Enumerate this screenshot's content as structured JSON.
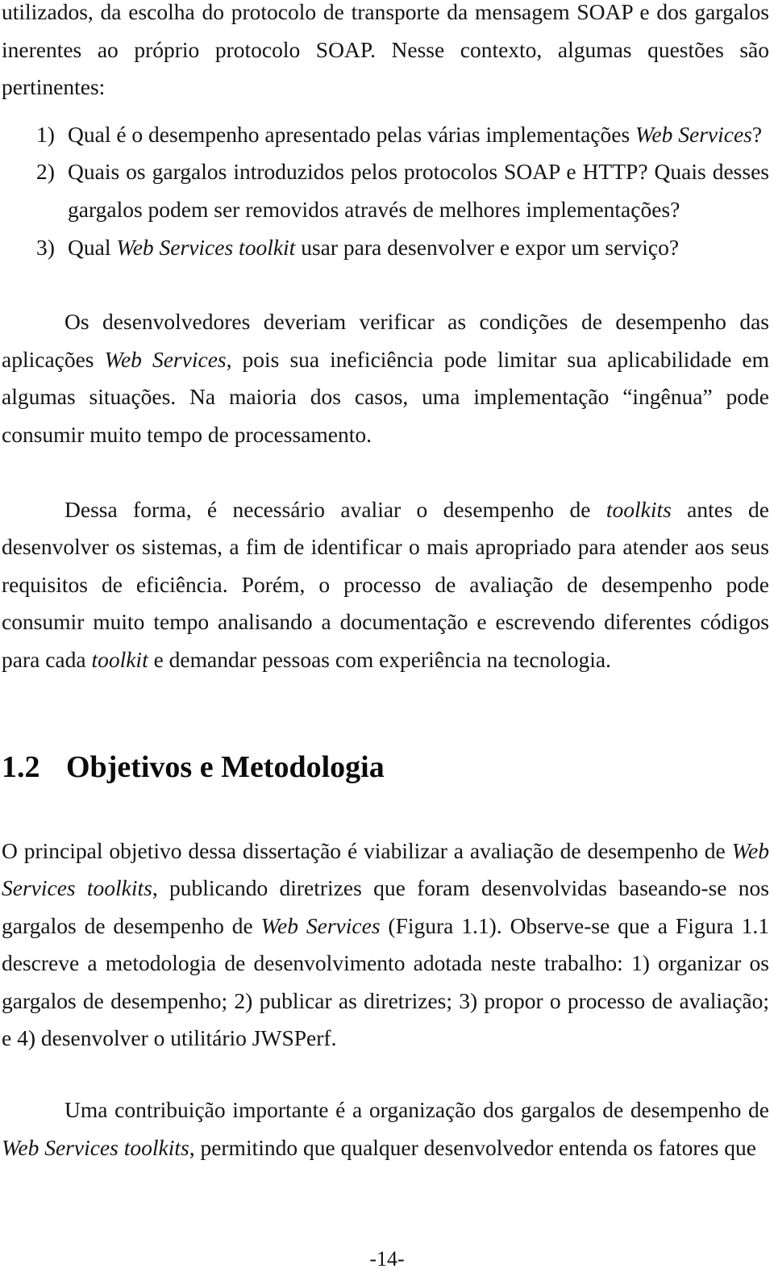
{
  "document": {
    "language": "pt-BR",
    "page_number_label": "-14-",
    "background_color": "#ffffff",
    "text_color": "#141414"
  },
  "body": {
    "paragraph_continuation": {
      "segments": [
        {
          "text": "utilizados, da escolha do protocolo de transporte da mensagem SOAP e dos gargalos inerentes ao próprio protocolo SOAP. Nesse contexto, algumas questões são pertinentes:",
          "style": "normal"
        }
      ]
    },
    "question_list": {
      "items": [
        {
          "marker": "1)",
          "segments": [
            {
              "text": "Qual é o desempenho apresentado pelas várias implementações ",
              "style": "normal"
            },
            {
              "text": "Web Services",
              "style": "italic"
            },
            {
              "text": "?",
              "style": "normal"
            }
          ]
        },
        {
          "marker": "2)",
          "segments": [
            {
              "text": "Quais os gargalos introduzidos pelos protocolos SOAP e HTTP? Quais desses gargalos podem ser removidos através de melhores implementações?",
              "style": "normal"
            }
          ]
        },
        {
          "marker": "3)",
          "segments": [
            {
              "text": "Qual ",
              "style": "normal"
            },
            {
              "text": "Web Services toolkit",
              "style": "italic"
            },
            {
              "text": " usar para desenvolver e expor um serviço?",
              "style": "normal"
            }
          ]
        }
      ]
    },
    "paragraph_developers": {
      "segments": [
        {
          "text": "Os desenvolvedores deveriam verificar as condições de desempenho das aplicações ",
          "style": "normal"
        },
        {
          "text": "Web Services",
          "style": "italic"
        },
        {
          "text": ", pois sua ineficiência pode limitar sua aplicabilidade em algumas situações. Na maioria dos casos, uma implementação “ingênua” pode consumir muito tempo de processamento.",
          "style": "normal"
        }
      ]
    },
    "paragraph_evaluation": {
      "segments": [
        {
          "text": "Dessa forma, é necessário avaliar o desempenho de ",
          "style": "normal"
        },
        {
          "text": "toolkits",
          "style": "italic"
        },
        {
          "text": " antes de desenvolver os sistemas, a fim de identificar o mais apropriado para atender aos seus requisitos de eficiência. Porém, o processo de avaliação de desempenho pode consumir muito tempo analisando a documentação e escrevendo diferentes códigos para cada ",
          "style": "normal"
        },
        {
          "text": "toolkit",
          "style": "italic"
        },
        {
          "text": " e demandar pessoas com experiência na tecnologia.",
          "style": "normal"
        }
      ]
    },
    "section_heading": {
      "number": "1.2",
      "title": "Objetivos e Metodologia"
    },
    "paragraph_objective": {
      "segments": [
        {
          "text": "O principal objetivo dessa dissertação é viabilizar a avaliação de desempenho de ",
          "style": "normal"
        },
        {
          "text": "Web Services toolkits",
          "style": "italic"
        },
        {
          "text": ", publicando diretrizes que foram desenvolvidas baseando-se nos gargalos de desempenho de ",
          "style": "normal"
        },
        {
          "text": "Web Services",
          "style": "italic"
        },
        {
          "text": " (Figura 1.1). Observe-se que a Figura 1.1 descreve a metodologia de desenvolvimento adotada neste trabalho: 1) organizar os gargalos de desempenho; 2) publicar as diretrizes; 3) propor o processo de avaliação; e 4) desenvolver o utilitário JWSPerf.",
          "style": "normal"
        }
      ]
    },
    "paragraph_contribution": {
      "segments": [
        {
          "text": "Uma contribuição importante é a organização dos gargalos de desempenho de ",
          "style": "normal"
        },
        {
          "text": "Web Services toolkits",
          "style": "italic"
        },
        {
          "text": ", permitindo que qualquer desenvolvedor entenda os fatores que",
          "style": "normal"
        }
      ]
    }
  }
}
